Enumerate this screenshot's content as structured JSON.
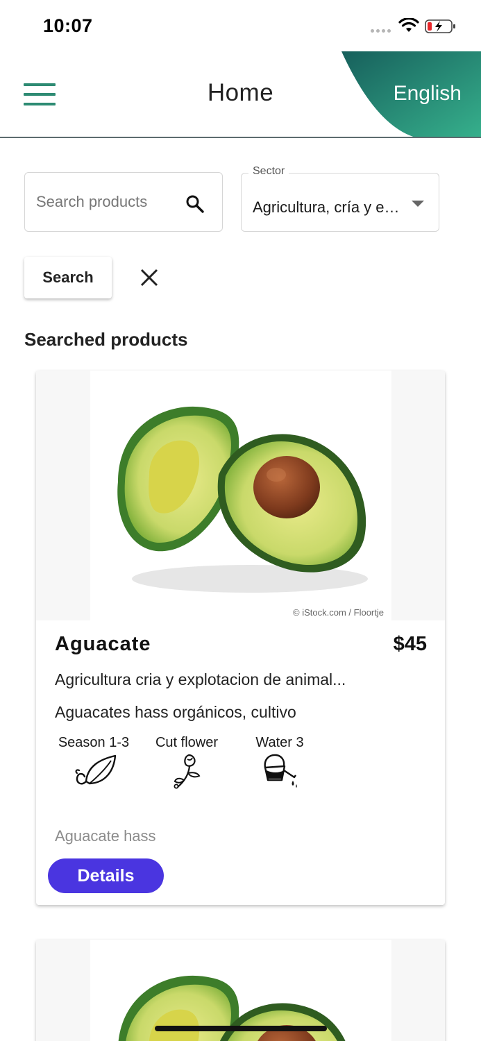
{
  "status_bar": {
    "time": "10:07",
    "icons": [
      "signal-dots-icon",
      "wifi-icon",
      "battery-charging-icon"
    ]
  },
  "header": {
    "menu_icon": "menu-icon",
    "title": "Home",
    "language": "English",
    "accent_color": "#2e8b73"
  },
  "search": {
    "placeholder": "Search products",
    "value": "",
    "icon": "search-icon",
    "sector_label": "Sector",
    "sector_value": "Agricultura, cría y explotación de animales",
    "button_label": "Search",
    "clear_icon": "close-icon"
  },
  "results": {
    "heading": "Searched products",
    "products": [
      {
        "photo_credit": "© iStock.com / Floortje",
        "name": "Aguacate",
        "price": "$45",
        "sector": "Agricultura cria y explotacion de animal...",
        "description": "Aguacates hass orgánicos, cultivo",
        "attributes": [
          {
            "label": "Season 1-3",
            "icon": "leaf-icon"
          },
          {
            "label": "Cut flower",
            "icon": "flower-icon"
          },
          {
            "label": "Water 3",
            "icon": "watering-can-icon"
          }
        ],
        "variety": "Aguacate hass",
        "details_label": "Details",
        "details_color": "#4a35e0"
      }
    ]
  }
}
